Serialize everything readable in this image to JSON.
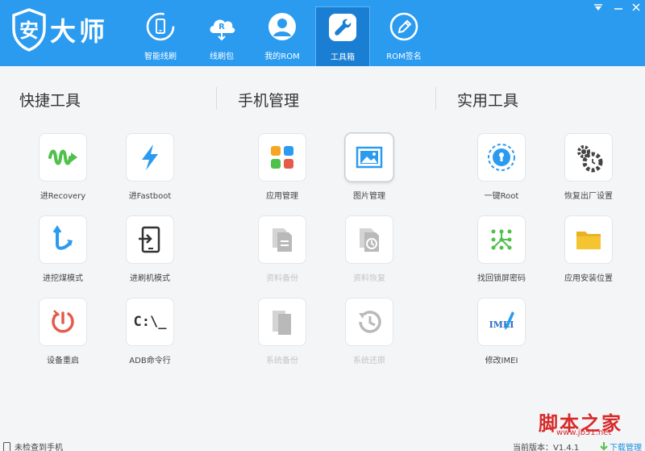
{
  "header": {
    "logo_text": "大师",
    "logo_glyph": "安",
    "nav": [
      {
        "label": "智能线刷",
        "icon": "phone-refresh-icon"
      },
      {
        "label": "线刷包",
        "icon": "cloud-download-icon"
      },
      {
        "label": "我的ROM",
        "icon": "user-icon"
      },
      {
        "label": "工具箱",
        "icon": "wrench-icon",
        "active": true
      },
      {
        "label": "ROM签名",
        "icon": "pen-icon"
      }
    ],
    "window_controls": [
      "minimize-menu",
      "minimize",
      "close"
    ]
  },
  "sections": [
    {
      "title": "快捷工具"
    },
    {
      "title": "手机管理"
    },
    {
      "title": "实用工具"
    }
  ],
  "tools": {
    "quick": [
      {
        "label": "进Recovery",
        "icon": "recovery-icon"
      },
      {
        "label": "进Fastboot",
        "icon": "lightning-icon"
      },
      {
        "label": "进挖煤模式",
        "icon": "arrow-curve-icon"
      },
      {
        "label": "进刷机模式",
        "icon": "phone-login-icon"
      },
      {
        "label": "设备重启",
        "icon": "restart-icon"
      },
      {
        "label": "ADB命令行",
        "icon": "terminal-icon",
        "glyph": "C:\\_"
      }
    ],
    "phone": [
      {
        "label": "应用管理",
        "icon": "apps-grid-icon"
      },
      {
        "label": "图片管理",
        "icon": "image-icon"
      },
      {
        "label": "资料备份",
        "icon": "data-backup-icon",
        "disabled": true
      },
      {
        "label": "资料恢复",
        "icon": "data-restore-icon",
        "disabled": true
      },
      {
        "label": "系统备份",
        "icon": "system-backup-icon",
        "disabled": true
      },
      {
        "label": "系统还原",
        "icon": "system-restore-icon",
        "disabled": true
      }
    ],
    "utility": [
      {
        "label": "一键Root",
        "icon": "root-lock-icon"
      },
      {
        "label": "恢复出厂设置",
        "icon": "gear-clock-icon"
      },
      {
        "label": "找回锁屏密码",
        "icon": "pattern-lock-icon"
      },
      {
        "label": "应用安装位置",
        "icon": "folder-icon"
      },
      {
        "label": "修改IMEI",
        "icon": "imei-edit-icon",
        "glyph": "IMEI"
      }
    ]
  },
  "status": {
    "device": "未检查到手机",
    "version": "当前版本：V1.4.1",
    "download": "下载管理"
  },
  "watermark": {
    "text": "脚本之家",
    "url": "www.jb51.net"
  },
  "colors": {
    "header": "#2b9bf0",
    "active_tab": "#1a7fd3",
    "background": "#f4f5f7",
    "accent_green": "#4fc14a",
    "accent_blue": "#2b9bf0",
    "accent_red": "#e55a4a",
    "watermark": "#d72a2a"
  }
}
